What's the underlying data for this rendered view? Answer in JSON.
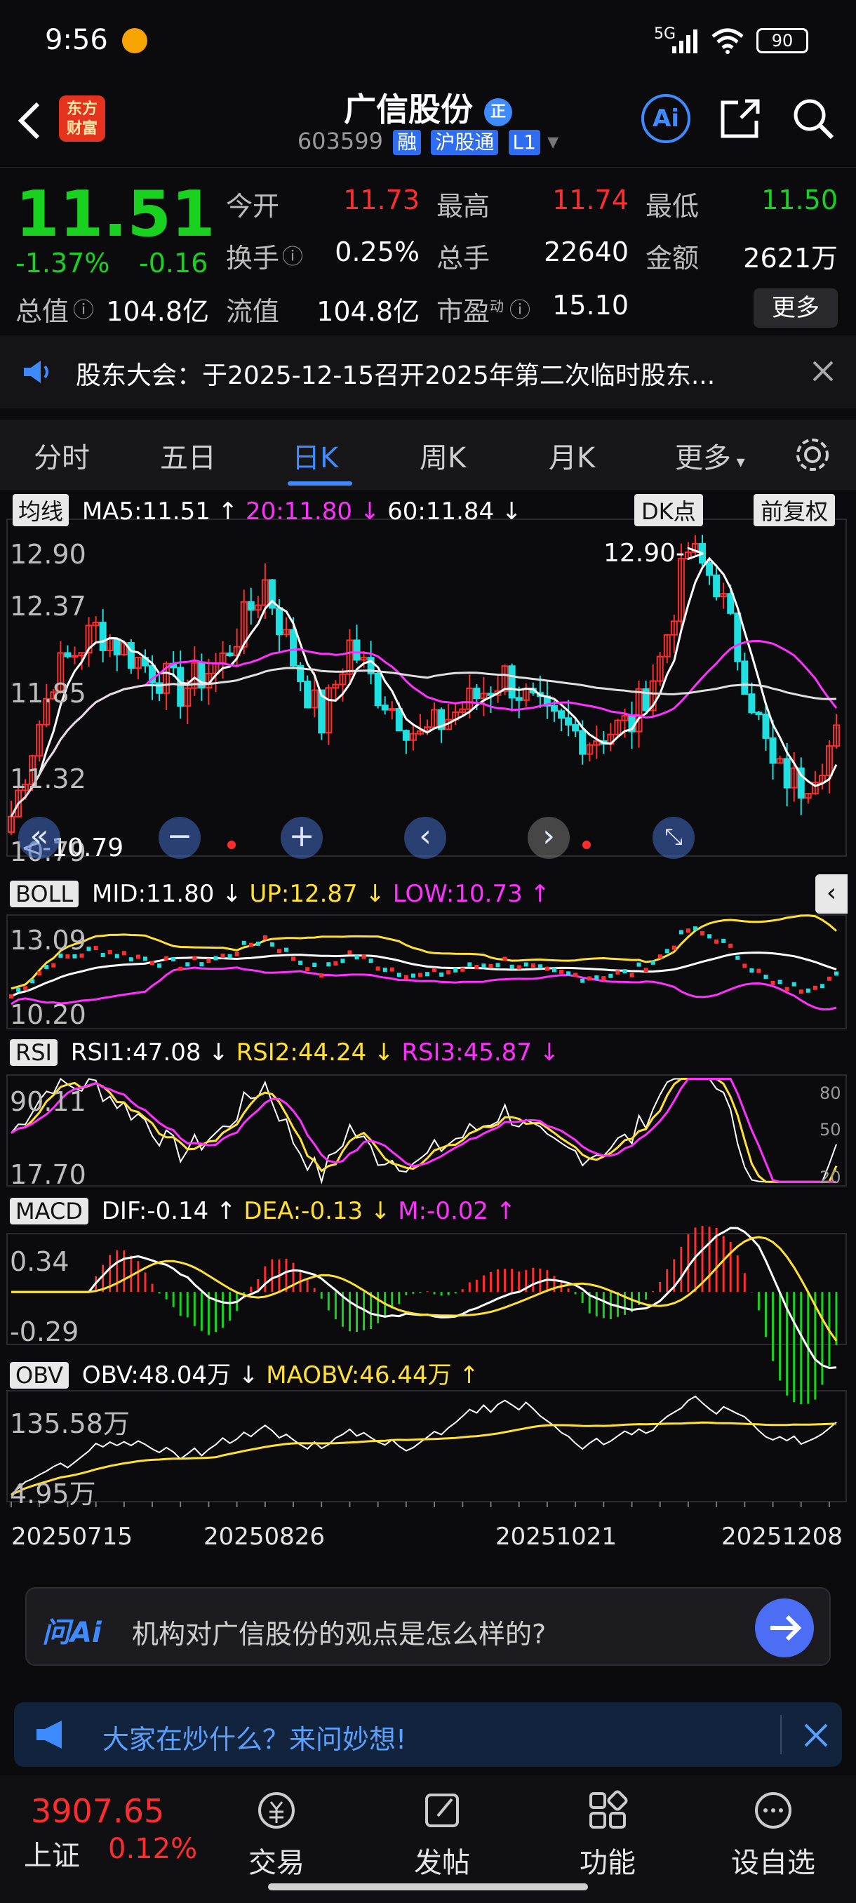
{
  "status_bar": {
    "time": "9:56",
    "network": "5G",
    "battery": "90"
  },
  "header": {
    "logo_line1": "东方",
    "logo_line2": "财富",
    "stock_name": "广信股份",
    "stock_badge": "正",
    "stock_code": "603599",
    "tag_margin": "融",
    "tag_connect": "沪股通",
    "tag_level": "L1",
    "ai_label": "Ai"
  },
  "quote": {
    "price": "11.51",
    "change_pct": "-1.37%",
    "change_abs": "-0.16",
    "open_label": "今开",
    "open_value": "11.73",
    "high_label": "最高",
    "high_value": "11.74",
    "low_label": "最低",
    "low_value": "11.50",
    "turnover_label": "换手",
    "turnover_value": "0.25%",
    "volume_label": "总手",
    "volume_value": "22640",
    "amount_label": "金额",
    "amount_value": "2621万",
    "mktcap_label": "总值",
    "mktcap_value": "104.8亿",
    "float_label": "流值",
    "float_value": "104.8亿",
    "pe_label": "市盈",
    "pe_sup": "动",
    "pe_value": "15.10",
    "more_button": "更多"
  },
  "notice": {
    "text": "股东大会：于2025-12-15召开2025年第二次临时股东..."
  },
  "tabs": [
    "分时",
    "五日",
    "日K",
    "周K",
    "月K",
    "更多"
  ],
  "active_tab": "日K",
  "kline": {
    "ma_chip": "均线",
    "ma5": "MA5:11.51 ↑",
    "ma20": "20:11.80 ↓",
    "ma60": "60:11.84 ↓",
    "dk_button": "DK点",
    "adjust_button": "前复权",
    "y_top": "12.90",
    "y_2": "12.37",
    "y_3": "11.85",
    "y_4": "11.32",
    "y_bottom": "10.79",
    "high_marker": "12.90->",
    "low_marker": "<-10.79"
  },
  "boll": {
    "chip": "BOLL",
    "mid": "MID:11.80 ↓",
    "up": "UP:12.87 ↓",
    "low": "LOW:10.73 ↑",
    "y_top": "13.09",
    "y_bottom": "10.20"
  },
  "rsi": {
    "chip": "RSI",
    "rsi1": "RSI1:47.08 ↓",
    "rsi2": "RSI2:44.24 ↓",
    "rsi3": "RSI3:45.87 ↓",
    "y_top": "90.11",
    "y_bottom": "17.70",
    "r80": "80",
    "r50": "50",
    "r20": "20"
  },
  "macd": {
    "chip": "MACD",
    "dif": "DIF:-0.14 ↑",
    "dea": "DEA:-0.13 ↓",
    "m": "M:-0.02 ↑",
    "y_top": "0.34",
    "y_bottom": "-0.29"
  },
  "obv": {
    "chip": "OBV",
    "obv": "OBV:48.04万 ↓",
    "maobv": "MAOBV:46.44万 ↑",
    "y_top": "135.58万",
    "y_bottom": "4.95万"
  },
  "dates": [
    "20250715",
    "20250826",
    "20251021",
    "20251208"
  ],
  "chart_data": {
    "type": "candlestick",
    "ylim": [
      10.79,
      12.9
    ],
    "ma_lines": [
      "MA5",
      "MA20",
      "MA60"
    ],
    "indicators": [
      "BOLL",
      "RSI",
      "MACD",
      "OBV"
    ],
    "x_ticks": [
      "20250715",
      "20250826",
      "20251021",
      "20251208"
    ],
    "highest": 12.9,
    "lowest": 10.79,
    "last_close": 11.51
  },
  "ask": {
    "logo": "问Ai",
    "prompt": "机构对广信股份的观点是怎么样的?"
  },
  "hot": {
    "text": "大家在炒什么？来问妙想!"
  },
  "bottom_nav": {
    "index_value": "3907.65",
    "index_name": "上证",
    "index_change": "0.12%",
    "items": [
      "交易",
      "发帖",
      "功能",
      "设自选"
    ]
  },
  "colors": {
    "up": "#ff2d2d",
    "down": "#19d21f",
    "accent": "#3d8bff",
    "ma5": "#ffffff",
    "ma20": "#ff31ff",
    "ma60": "#e0e0e0",
    "boll_up": "#ffe033",
    "candle_down": "#1ee0e0"
  }
}
